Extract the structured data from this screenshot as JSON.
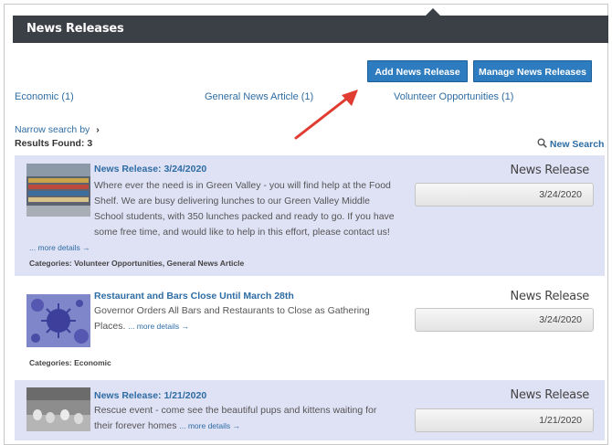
{
  "header": {
    "title": "News Releases"
  },
  "toolbar": {
    "add_label": "Add News Release",
    "manage_label": "Manage News Releases"
  },
  "categories": [
    {
      "label": "Economic (1)"
    },
    {
      "label": "General News Article (1)"
    },
    {
      "label": "Volunteer Opportunities (1)"
    }
  ],
  "search": {
    "narrow_label": "Narrow search by",
    "results_label": "Results Found: 3",
    "new_search_label": "New Search"
  },
  "items": [
    {
      "title": "News Release: 3/24/2020",
      "description": "Where ever the need is in Green Valley - you will find help at the Food Shelf. We are busy delivering lunches to our Green Valley Middle School students, with 350 lunches packed and ready to go. If you have some free time, and would like to help in this effort, please contact us!",
      "more": "... more details →",
      "categories": "Categories: Volunteer Opportunities, General News Article",
      "type": "News Release",
      "date": "3/24/2020"
    },
    {
      "title": "Restaurant and Bars Close Until March 28th",
      "description": "Governor Orders All Bars and Restaurants to Close as Gathering Places.",
      "more": "... more details →",
      "categories": "Categories: Economic",
      "type": "News Release",
      "date": "3/24/2020"
    },
    {
      "title": "News Release: 1/21/2020",
      "description": "Rescue event - come see the beautiful pups and kittens waiting for their forever homes",
      "more": "... more details →",
      "type": "News Release",
      "date": "1/21/2020"
    }
  ],
  "colors": {
    "header_bg": "#3b4046",
    "button_bg": "#2e7cc0",
    "link": "#2e6da4",
    "card_shade": "#dfe1f5",
    "arrow": "#e03c31"
  }
}
